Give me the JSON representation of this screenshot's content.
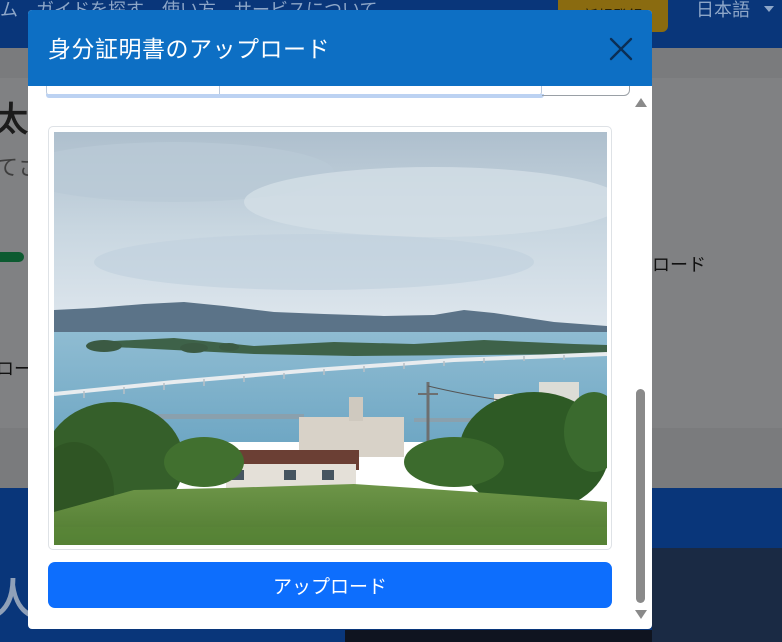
{
  "background": {
    "nav_text": "ム　ガイドを探す　使い方　サービスについて",
    "signup_label": "新規登録",
    "language": "日本語",
    "title_fragment": "太郎",
    "subtitle_fragment": "てさ",
    "upload_right_fragment": "ロード",
    "upload_left_fragment": "ロー",
    "bottom_text_fragment": "人"
  },
  "modal": {
    "title": "身分証明書のアップロード",
    "close_label": "×",
    "preview_alt": "アップロード画像のプレビュー",
    "upload_button": "アップロード"
  },
  "colors": {
    "header": "#0d6fc4",
    "primary_button": "#0d6efd",
    "overlay": "#6f7072"
  }
}
